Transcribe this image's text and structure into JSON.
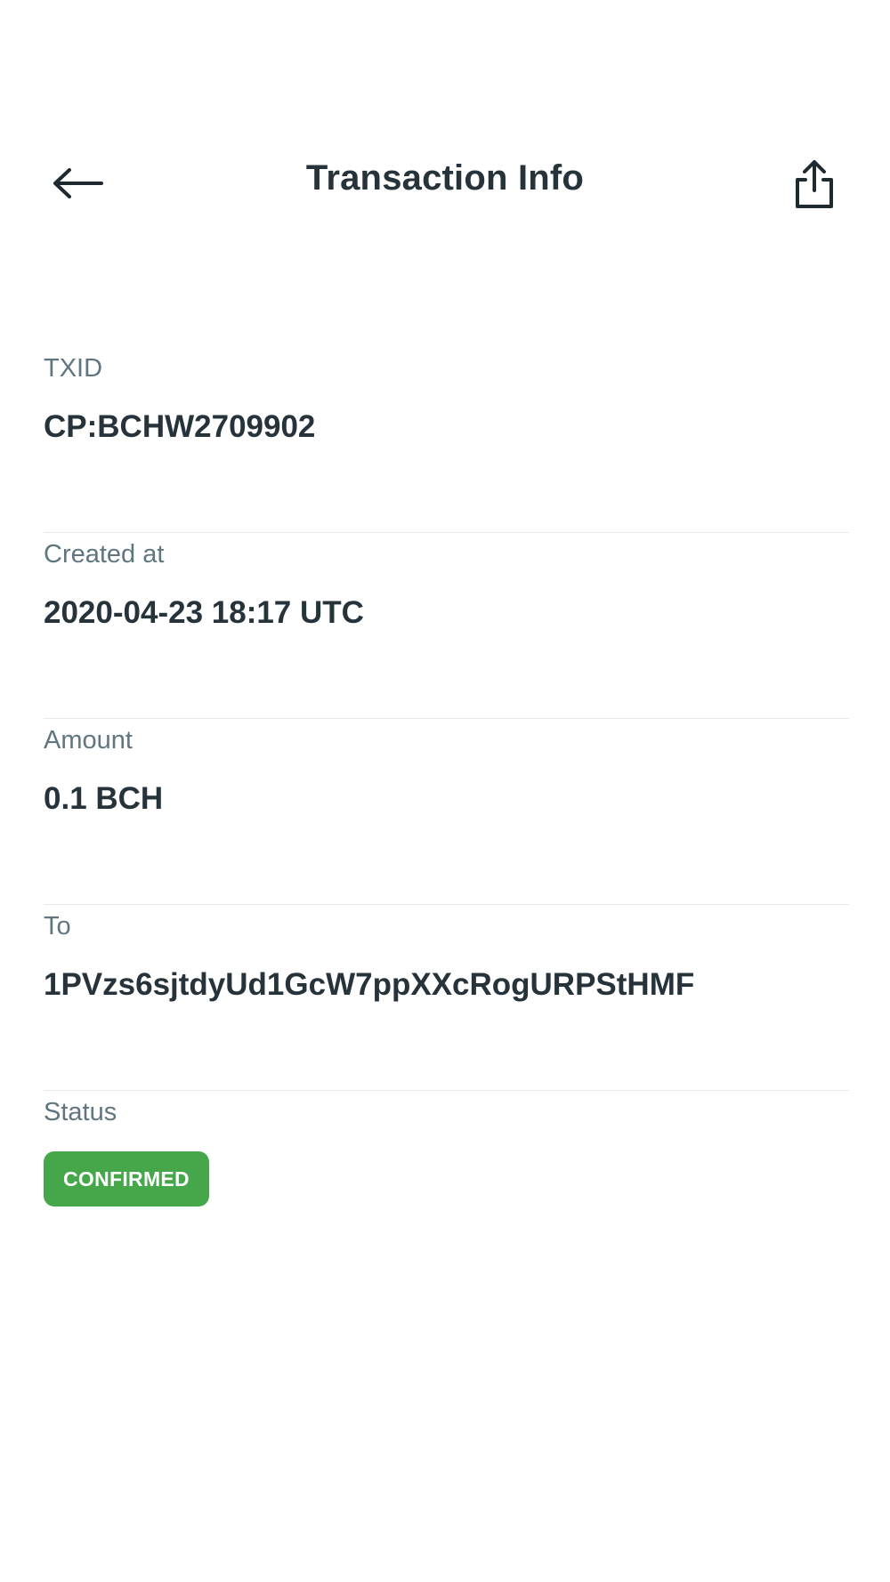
{
  "header": {
    "title": "Transaction Info",
    "back_icon": "arrow-left-icon",
    "share_icon": "share-icon"
  },
  "fields": [
    {
      "label": "TXID",
      "value": "CP:BCHW2709902"
    },
    {
      "label": "Created at",
      "value": "2020-04-23 18:17 UTC"
    },
    {
      "label": "Amount",
      "value": "0.1 BCH"
    },
    {
      "label": "To",
      "value": "1PVzs6sjtdyUd1GcW7ppXXcRogURPStHMF"
    }
  ],
  "status": {
    "label": "Status",
    "value": "CONFIRMED",
    "color": "#46a74a"
  }
}
